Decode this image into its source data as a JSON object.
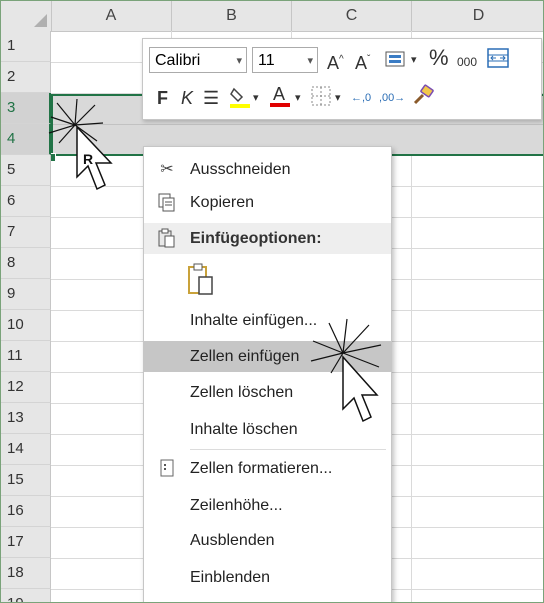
{
  "columns": [
    "A",
    "B",
    "C",
    "D"
  ],
  "rows": [
    "1",
    "2",
    "3",
    "4",
    "5",
    "6",
    "7",
    "8",
    "9",
    "10",
    "11",
    "12",
    "13",
    "14",
    "15",
    "16",
    "17",
    "18",
    "19"
  ],
  "selected_rows": [
    "3",
    "4"
  ],
  "mini_toolbar": {
    "font": "Calibri",
    "size": "11",
    "bold": "F",
    "italic": "K",
    "percent": "%",
    "thousands": "000"
  },
  "context_menu": {
    "cut": "Ausschneiden",
    "copy": "Kopieren",
    "paste_options": "Einfügeoptionen:",
    "paste_special": "Inhalte einfügen...",
    "insert_cells": "Zellen einfügen",
    "delete_cells": "Zellen löschen",
    "clear_contents": "Inhalte löschen",
    "format_cells": "Zellen formatieren...",
    "row_height": "Zeilenhöhe...",
    "hide": "Ausblenden",
    "unhide": "Einblenden"
  },
  "cursor_label": "R",
  "colors": {
    "accent": "#217346",
    "highlight": "#c6c6c6",
    "selection_fill": "#d9d9d9"
  },
  "icons": [
    "scissors-icon",
    "copy-icon",
    "clipboard-icon",
    "format-cells-icon",
    "font-grow-icon",
    "font-shrink-icon",
    "format-painter-icon"
  ]
}
